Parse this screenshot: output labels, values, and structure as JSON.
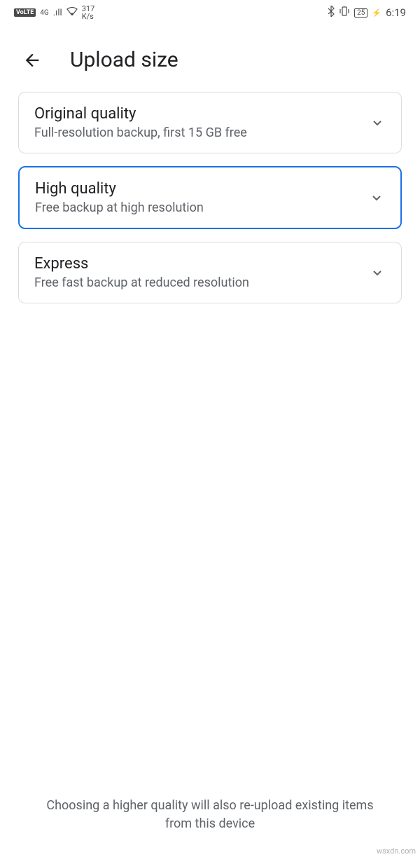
{
  "status_bar": {
    "volte": "VoLTE",
    "network": "4G",
    "signal": ".ıll",
    "wifi": "⧊",
    "speed_top": "317",
    "speed_bottom": "K/s",
    "bluetooth": "✱",
    "vibrate": "▮▯▮",
    "battery": "25",
    "time": "6:19"
  },
  "header": {
    "title": "Upload size"
  },
  "options": [
    {
      "title": "Original quality",
      "subtitle": "Full-resolution backup, first 15 GB free",
      "selected": false
    },
    {
      "title": "High quality",
      "subtitle": "Free backup at high resolution",
      "selected": true
    },
    {
      "title": "Express",
      "subtitle": "Free fast backup at reduced resolution",
      "selected": false
    }
  ],
  "footer": "Choosing a higher quality will also re-upload existing items from this device",
  "watermark": "wsxdn.com"
}
